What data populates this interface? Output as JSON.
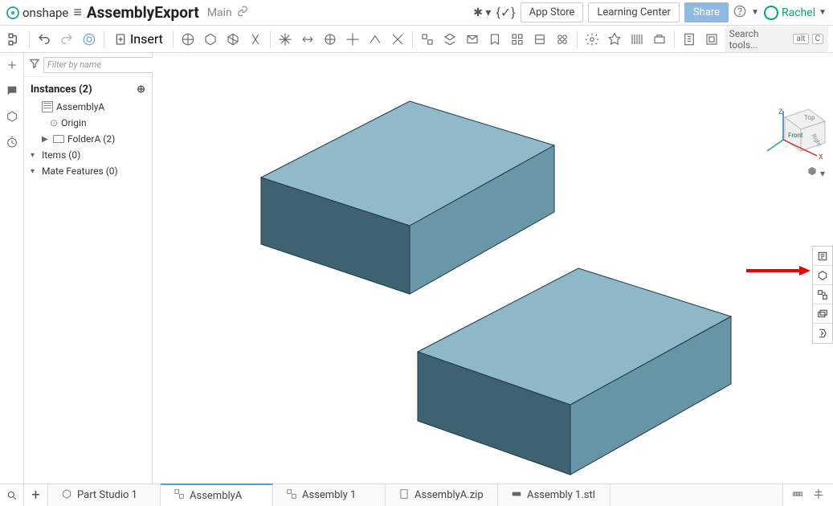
{
  "header": {
    "brand": "onshape",
    "doc_title": "AssemblyExport",
    "branch": "Main",
    "app_store": "App Store",
    "learning_center": "Learning Center",
    "share": "Share",
    "user_name": "Rachel"
  },
  "toolbar": {
    "insert_label": "Insert",
    "search_placeholder": "Search tools...",
    "kbd1": "alt",
    "kbd2": "C"
  },
  "sidebar": {
    "filter_placeholder": "Filter by name",
    "instances_label": "Instances (2)",
    "items": [
      {
        "label": "AssemblyA",
        "type": "assembly"
      },
      {
        "label": "Origin",
        "type": "origin"
      },
      {
        "label": "FolderA (2)",
        "type": "folder"
      },
      {
        "label": "Items (0)",
        "type": "section"
      },
      {
        "label": "Mate Features (0)",
        "type": "section"
      }
    ]
  },
  "triad": {
    "x": "X",
    "y": "",
    "z": "Z",
    "top": "Top",
    "front": "Front",
    "right": "Right"
  },
  "footer": {
    "tabs": [
      {
        "label": "Part Studio 1",
        "icon": "part",
        "active": false
      },
      {
        "label": "AssemblyA",
        "icon": "assembly",
        "active": true
      },
      {
        "label": "Assembly 1",
        "icon": "assembly",
        "active": false
      },
      {
        "label": "AssemblyA.zip",
        "icon": "file",
        "active": false
      },
      {
        "label": "Assembly 1.stl",
        "icon": "stl",
        "active": false
      }
    ]
  }
}
